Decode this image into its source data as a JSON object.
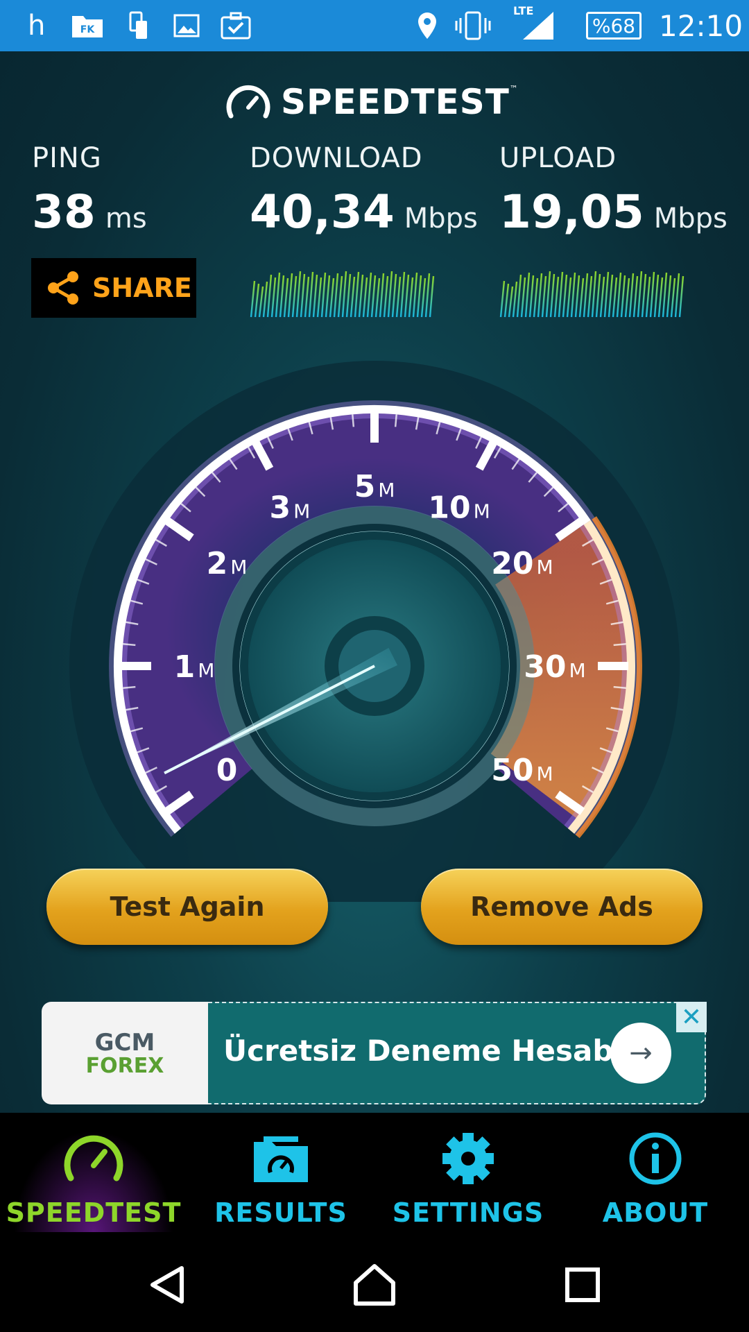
{
  "status_bar": {
    "carrier_letter": "h",
    "network": "LTE",
    "battery": "%68",
    "time": "12:10"
  },
  "header": {
    "brand": "SPEEDTEST",
    "trademark": "™"
  },
  "metrics": {
    "ping": {
      "label": "PING",
      "value": "38",
      "unit": "ms"
    },
    "download": {
      "label": "DOWNLOAD",
      "value": "40,34",
      "unit": "Mbps"
    },
    "upload": {
      "label": "UPLOAD",
      "value": "19,05",
      "unit": "Mbps"
    }
  },
  "share": {
    "label": "SHARE"
  },
  "gauge": {
    "ticks": [
      {
        "num": "0",
        "suffix": ""
      },
      {
        "num": "1",
        "suffix": "M"
      },
      {
        "num": "2",
        "suffix": "M"
      },
      {
        "num": "3",
        "suffix": "M"
      },
      {
        "num": "5",
        "suffix": "M"
      },
      {
        "num": "10",
        "suffix": "M"
      },
      {
        "num": "20",
        "suffix": "M"
      },
      {
        "num": "30",
        "suffix": "M"
      },
      {
        "num": "50",
        "suffix": "M"
      }
    ],
    "needle_reading": "0"
  },
  "buttons": {
    "test_again": "Test Again",
    "remove_ads": "Remove Ads"
  },
  "ad": {
    "logo_top": "GCM",
    "logo_bottom": "FOREX",
    "headline": "Ücretsiz Deneme Hesabı",
    "arrow": "→",
    "close": "✕"
  },
  "nav": {
    "items": [
      {
        "label": "SPEEDTEST",
        "icon": "speedometer-icon",
        "active": true
      },
      {
        "label": "RESULTS",
        "icon": "results-folder-icon",
        "active": false
      },
      {
        "label": "SETTINGS",
        "icon": "gear-icon",
        "active": false
      },
      {
        "label": "ABOUT",
        "icon": "info-icon",
        "active": false
      }
    ]
  },
  "colors": {
    "status_bar": "#1b8ad8",
    "accent_orange": "#ffa31a",
    "active_green": "#8ed62a",
    "nav_blue": "#1ec3e8",
    "button_gold": "#e3a21d"
  }
}
